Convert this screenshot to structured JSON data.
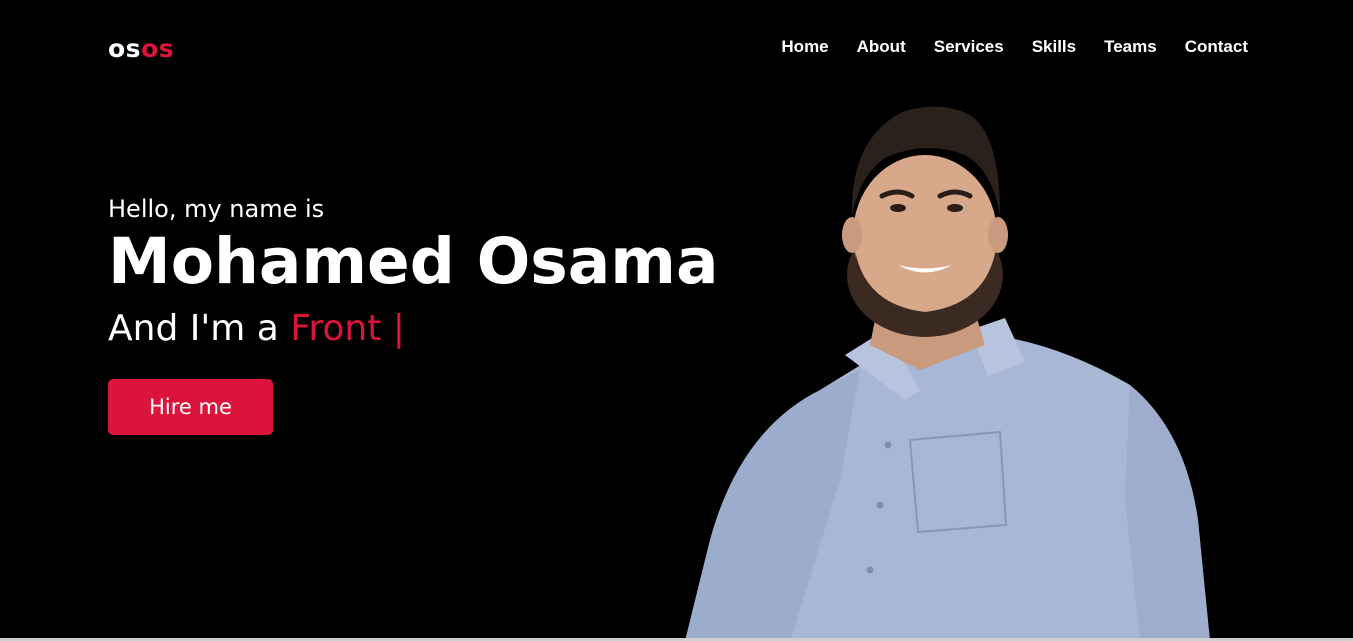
{
  "brand": {
    "logo_part1": "os",
    "logo_part2": "os"
  },
  "nav": {
    "items": [
      {
        "label": "Home"
      },
      {
        "label": "About"
      },
      {
        "label": "Services"
      },
      {
        "label": "Skills"
      },
      {
        "label": "Teams"
      },
      {
        "label": "Contact"
      }
    ]
  },
  "hero": {
    "greeting": "Hello, my name is",
    "name": "Mohamed Osama",
    "role_prefix": "And I'm a",
    "role_typed": "Front |",
    "cta_label": "Hire me"
  },
  "colors": {
    "background": "#000000",
    "accent": "#dc143c",
    "text": "#ffffff",
    "shirt": "#aab8d6"
  },
  "icons": {
    "portrait": "person-photo"
  }
}
